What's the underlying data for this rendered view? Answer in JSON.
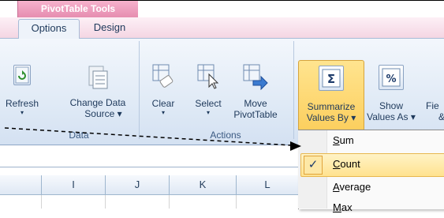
{
  "ribbon": {
    "context_header": "PivotTable Tools",
    "tabs": [
      "Options",
      "Design"
    ],
    "buttons": {
      "refresh": {
        "label": "Refresh",
        "arrow": "▾"
      },
      "change_data_source": {
        "line1": "Change Data",
        "line2": "Source ▾"
      },
      "clear": {
        "label": "Clear",
        "arrow": "▾"
      },
      "select": {
        "label": "Select",
        "arrow": "▾"
      },
      "move_pivottable": {
        "line1": "Move",
        "line2": "PivotTable"
      },
      "summarize_values_by": {
        "line1": "Summarize",
        "line2": "Values By ▾"
      },
      "show_values_as": {
        "line1": "Show",
        "line2": "Values As ▾"
      },
      "fields_partial": {
        "line1": "Fie",
        "line2": "&"
      }
    },
    "groups": {
      "data": "Data",
      "actions": "Actions"
    }
  },
  "grid": {
    "columns": [
      "I",
      "J",
      "K",
      "L"
    ]
  },
  "menu": {
    "items": [
      {
        "label": "Sum",
        "accel": "S",
        "checked": false
      },
      {
        "label": "Count",
        "accel": "C",
        "checked": true
      },
      {
        "label": "Average",
        "accel": "A",
        "checked": false
      },
      {
        "label": "Max",
        "accel": "M",
        "checked": false
      }
    ],
    "check_mark": "✓"
  },
  "colors": {
    "accent_highlight": "#fccf5e",
    "context_tab": "#e68db0",
    "ribbon_bg": "#dde8f5"
  }
}
